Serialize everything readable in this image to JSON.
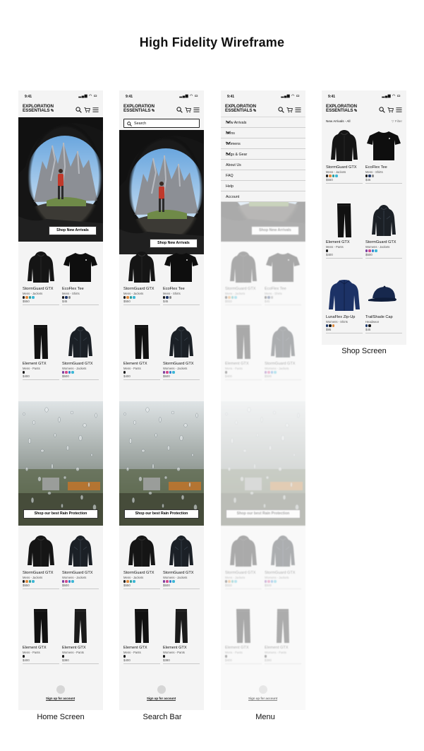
{
  "page_title": "High Fidelity Wireframe",
  "status": {
    "time": "9:41",
    "icons": "▂▄▆ ◠ ▭"
  },
  "logo": {
    "line1": "EXPLORATION",
    "line2": "ESSENTIALS"
  },
  "hero": {
    "button_label": "Shop New Arrivals"
  },
  "rain": {
    "button_label": "Shop our best Rain Protection"
  },
  "footer": {
    "signup_label": "Sign up for account"
  },
  "search": {
    "placeholder": "Search"
  },
  "menu_items": [
    {
      "label": "New Arrivals",
      "expandable": true
    },
    {
      "label": "Mens",
      "expandable": true
    },
    {
      "label": "Womens",
      "expandable": true
    },
    {
      "label": "Bags & Gear",
      "expandable": true
    },
    {
      "label": "About Us",
      "expandable": false
    },
    {
      "label": "FAQ",
      "expandable": false
    },
    {
      "label": "Help",
      "expandable": false
    },
    {
      "label": "Account",
      "expandable": false
    }
  ],
  "shop": {
    "breadcrumb": "New Arrivals - All",
    "filter_label": "Filter"
  },
  "colors": {
    "black": "#1a1a1a",
    "orange": "#e08a3c",
    "teal": "#2a9d9a",
    "navy": "#1f3a6e",
    "gray": "#8a8a8a",
    "purple": "#7a3fa0",
    "pink": "#d24b8c",
    "blue": "#2f7fd0",
    "cyan": "#3db7d6"
  },
  "products_a": [
    {
      "name": "StormGuard GTX",
      "category": "Mens - Jackets",
      "price": "$550",
      "shape": "jacket",
      "swatches": [
        "#1a1a1a",
        "#e08a3c",
        "#2a9d9a",
        "#3db7d6"
      ]
    },
    {
      "name": "EcoFlex Tee",
      "category": "Mens - Shirts",
      "price": "$45",
      "shape": "tee",
      "swatches": [
        "#1a1a1a",
        "#1f3a6e",
        "#8a8a8a"
      ]
    },
    {
      "name": "Element GTX",
      "category": "Mens - Pants",
      "price": "$400",
      "shape": "pants",
      "swatches": [
        "#1a1a1a"
      ]
    },
    {
      "name": "StormGuard GTX",
      "category": "Womens - Jackets",
      "price": "$500",
      "shape": "jacket-f",
      "swatches": [
        "#7a3fa0",
        "#d24b8c",
        "#2f7fd0",
        "#3db7d6"
      ]
    }
  ],
  "products_b": [
    {
      "name": "StormGuard GTX",
      "category": "Mens - Jackets",
      "price": "$550",
      "shape": "jacket",
      "swatches": [
        "#1a1a1a",
        "#e08a3c",
        "#2a9d9a",
        "#3db7d6"
      ]
    },
    {
      "name": "StormGuard GTX",
      "category": "Womens - Jackets",
      "price": "$500",
      "shape": "jacket-f",
      "swatches": [
        "#7a3fa0",
        "#d24b8c",
        "#2f7fd0",
        "#3db7d6"
      ]
    },
    {
      "name": "Element GTX",
      "category": "Mens - Pants",
      "price": "$400",
      "shape": "pants",
      "swatches": [
        "#1a1a1a"
      ]
    },
    {
      "name": "Element GTX",
      "category": "Womens - Pants",
      "price": "$380",
      "shape": "pants-f",
      "swatches": [
        "#1a1a1a"
      ]
    }
  ],
  "products_shop": [
    {
      "name": "StormGuard GTX",
      "category": "Mens - Jackets",
      "price": "$550",
      "shape": "jacket",
      "swatches": [
        "#1a1a1a",
        "#e08a3c",
        "#2a9d9a",
        "#3db7d6"
      ]
    },
    {
      "name": "EcoFlex Tee",
      "category": "Mens - Shirts",
      "price": "$45",
      "shape": "tee",
      "swatches": [
        "#1a1a1a",
        "#1f3a6e",
        "#8a8a8a"
      ]
    },
    {
      "name": "Element GTX",
      "category": "Mens - Pants",
      "price": "$400",
      "shape": "pants",
      "swatches": [
        "#1a1a1a"
      ]
    },
    {
      "name": "StormGuard GTX",
      "category": "Womens - Jackets",
      "price": "$500",
      "shape": "jacket-f",
      "swatches": [
        "#7a3fa0",
        "#d24b8c",
        "#2f7fd0",
        "#3db7d6"
      ]
    },
    {
      "name": "LunaFlex Zip-Up",
      "category": "Womens - Shirts",
      "price": "$95",
      "shape": "zipup",
      "swatches": [
        "#1f3a6e",
        "#1a1a1a",
        "#e08a3c"
      ]
    },
    {
      "name": "TrailShade Cap",
      "category": "Headwear",
      "price": "$45",
      "shape": "cap",
      "swatches": [
        "#1f3a6e",
        "#1a1a1a"
      ]
    }
  ],
  "screens": [
    {
      "key": "home",
      "caption": "Home Screen"
    },
    {
      "key": "search",
      "caption": "Search Bar"
    },
    {
      "key": "menu",
      "caption": "Menu"
    },
    {
      "key": "shop",
      "caption": "Shop Screen"
    }
  ]
}
